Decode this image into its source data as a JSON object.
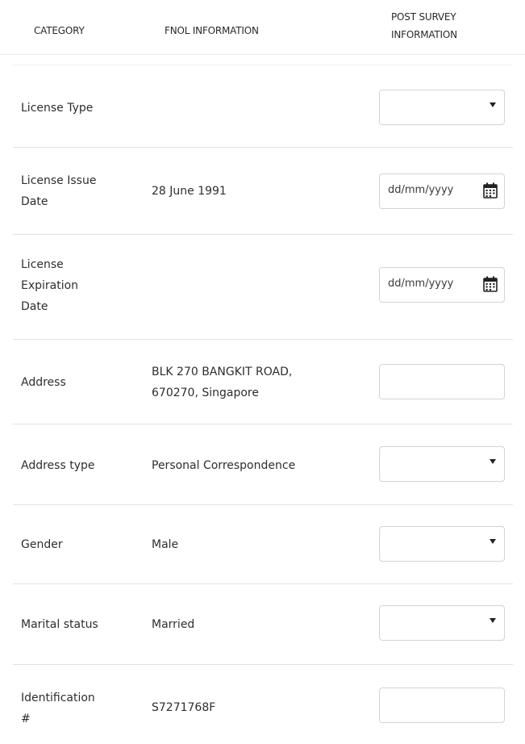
{
  "header": {
    "category": "CATEGORY",
    "fnol": "FNOL INFORMATION",
    "post_survey_line1": "POST SURVEY",
    "post_survey_line2": "INFORMATION"
  },
  "rows": [
    {
      "category": "License Type",
      "fnol": "",
      "control": "select",
      "value": ""
    },
    {
      "category_line1": "License Issue",
      "category_line2": "Date",
      "fnol": "28 June 1991",
      "control": "date",
      "placeholder": "dd/mm/yyyy"
    },
    {
      "category_line1": "License",
      "category_line2": "Expiration",
      "category_line3": "Date",
      "fnol": "",
      "control": "date",
      "placeholder": "dd/mm/yyyy"
    },
    {
      "category": "Address",
      "fnol_line1": "BLK 270 BANGKIT ROAD,",
      "fnol_line2": "670270, Singapore",
      "control": "text",
      "value": ""
    },
    {
      "category": "Address type",
      "fnol": "Personal Correspondence",
      "control": "select",
      "value": ""
    },
    {
      "category": "Gender",
      "fnol": "Male",
      "control": "select",
      "value": ""
    },
    {
      "category": "Marital status",
      "fnol": "Married",
      "control": "select",
      "value": ""
    },
    {
      "category_line1": "Identification",
      "category_line2": "#",
      "fnol": "S7271768F",
      "control": "text",
      "value": ""
    }
  ],
  "icons": {
    "select_caret": "chevron-down-icon",
    "date_picker": "calendar-icon"
  }
}
